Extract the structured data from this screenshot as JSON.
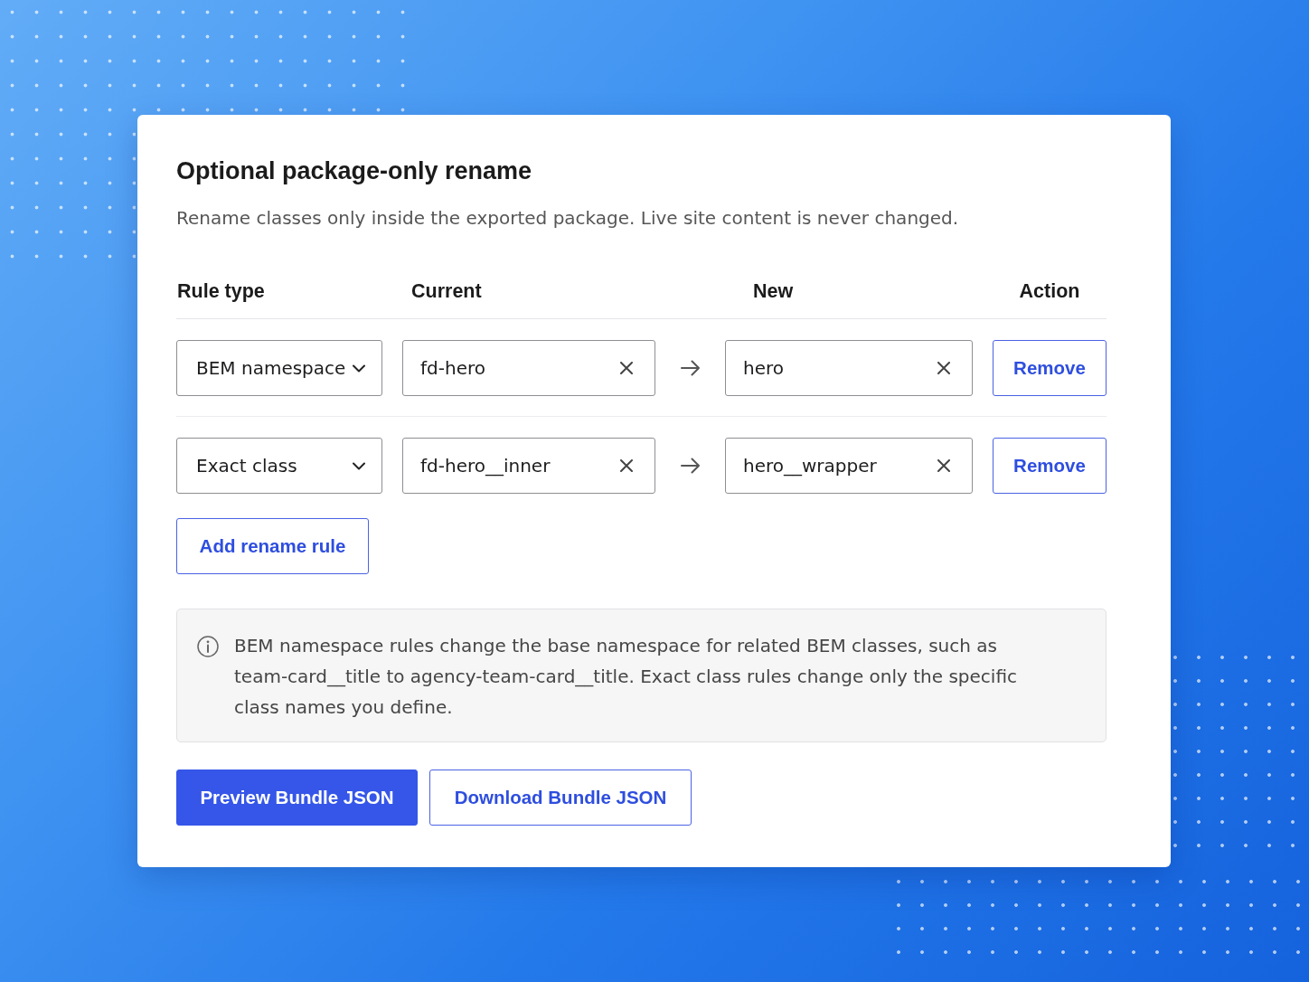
{
  "card": {
    "title": "Optional package-only rename",
    "description": "Rename classes only inside the exported package. Live site content is never changed."
  },
  "table": {
    "columns": [
      "Rule type",
      "Current",
      "New",
      "Action"
    ],
    "rows": [
      {
        "rule_type": "BEM namespace",
        "current": "fd-hero",
        "new": "hero",
        "action": "Remove"
      },
      {
        "rule_type": "Exact class",
        "current": "fd-hero__inner",
        "new": "hero__wrapper",
        "action": "Remove"
      }
    ]
  },
  "add_rule_button": "Add rename rule",
  "info_note": "BEM namespace rules change the base namespace for related BEM classes, such as team-card__title to agency-team-card__title. Exact class rules change only the specific class names you define.",
  "buttons": [
    {
      "label": "Preview Bundle JSON",
      "kind": "primary"
    },
    {
      "label": "Download Bundle JSON",
      "kind": "secondary"
    }
  ]
}
